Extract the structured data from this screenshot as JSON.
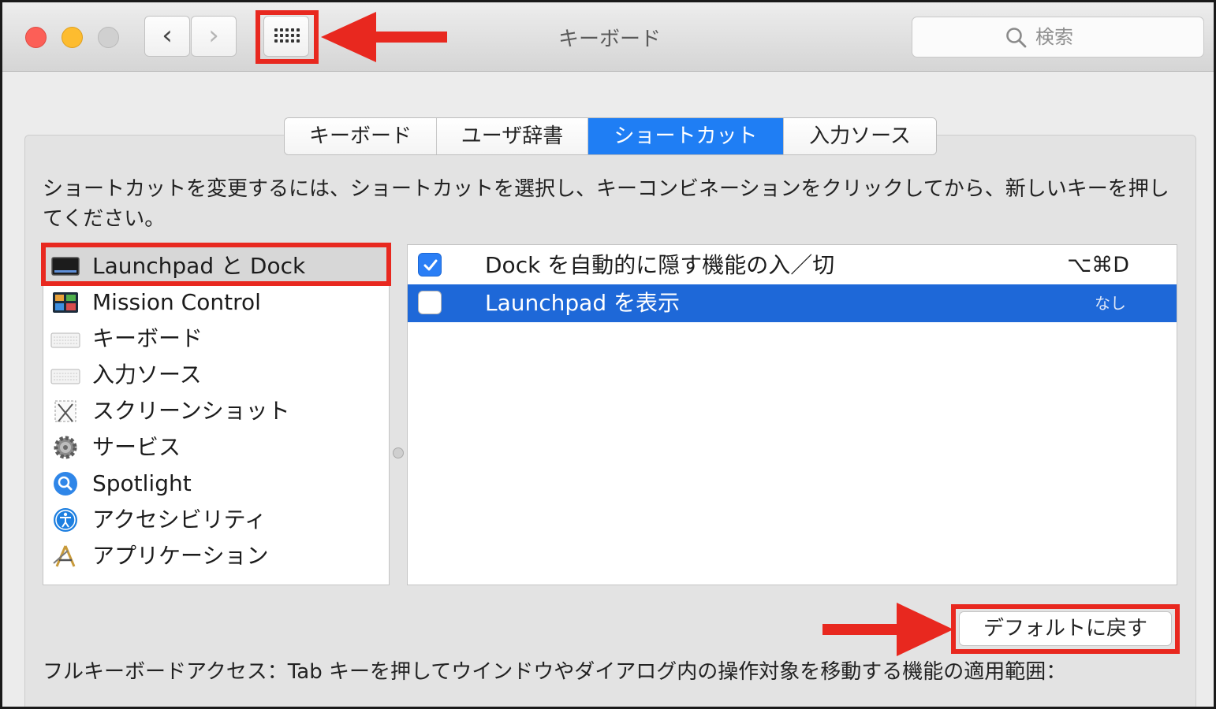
{
  "window": {
    "title": "キーボード",
    "nav_back": "‹",
    "nav_forward": "›",
    "search_placeholder": "検索"
  },
  "tabs": [
    {
      "label": "キーボード",
      "active": false
    },
    {
      "label": "ユーザ辞書",
      "active": false
    },
    {
      "label": "ショートカット",
      "active": true
    },
    {
      "label": "入力ソース",
      "active": false
    }
  ],
  "instruction": "ショートカットを変更するには、ショートカットを選択し、キーコンビネーションをクリックしてから、新しいキーを押してください。",
  "categories": [
    {
      "label": "Launchpad と Dock",
      "icon": "launchpad-dock-icon",
      "selected": true
    },
    {
      "label": "Mission Control",
      "icon": "mission-control-icon",
      "selected": false
    },
    {
      "label": "キーボード",
      "icon": "keyboard-icon",
      "selected": false
    },
    {
      "label": "入力ソース",
      "icon": "input-source-icon",
      "selected": false
    },
    {
      "label": "スクリーンショット",
      "icon": "screenshot-icon",
      "selected": false
    },
    {
      "label": "サービス",
      "icon": "services-gear-icon",
      "selected": false
    },
    {
      "label": "Spotlight",
      "icon": "spotlight-icon",
      "selected": false
    },
    {
      "label": "アクセシビリティ",
      "icon": "accessibility-icon",
      "selected": false
    },
    {
      "label": "アプリケーション",
      "icon": "applications-icon",
      "selected": false
    }
  ],
  "shortcuts": [
    {
      "label": "Dock を自動的に隠す機能の入／切",
      "key": "⌥⌘D",
      "checked": true,
      "selected": false
    },
    {
      "label": "Launchpad を表示",
      "key": "なし",
      "checked": false,
      "selected": true
    }
  ],
  "restore_default_label": "デフォルトに戻す",
  "footer": "フルキーボードアクセス：Tab キーを押してウインドウやダイアログ内の操作対象を移動する機能の適用範囲：",
  "colors": {
    "accent": "#1f7ef4",
    "selection": "#1e68d8",
    "annotation": "#e8281f"
  }
}
